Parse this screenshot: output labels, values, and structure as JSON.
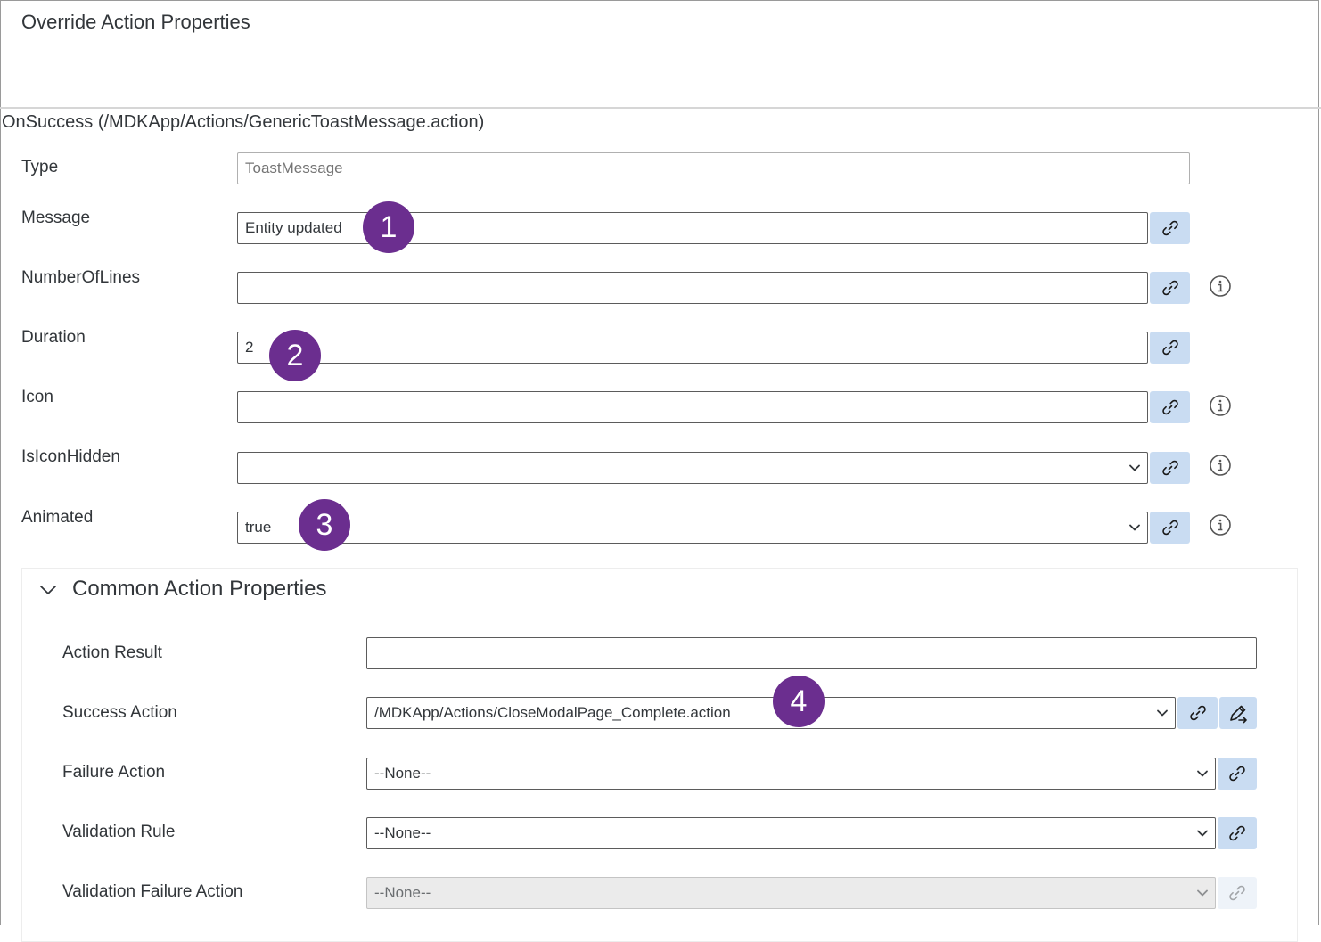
{
  "header": {
    "title": "Override Action Properties"
  },
  "section": {
    "title": "OnSuccess (/MDKApp/Actions/GenericToastMessage.action)"
  },
  "fields": {
    "type": {
      "label": "Type",
      "placeholder": "ToastMessage"
    },
    "message": {
      "label": "Message",
      "value": "Entity updated"
    },
    "number_of_lines": {
      "label": "NumberOfLines",
      "value": ""
    },
    "duration": {
      "label": "Duration",
      "value": "2"
    },
    "icon": {
      "label": "Icon",
      "value": ""
    },
    "is_icon_hidden": {
      "label": "IsIconHidden",
      "selected": ""
    },
    "animated": {
      "label": "Animated",
      "selected": "true"
    }
  },
  "common": {
    "title": "Common Action Properties",
    "action_result": {
      "label": "Action Result",
      "value": ""
    },
    "success_action": {
      "label": "Success Action",
      "selected": "/MDKApp/Actions/CloseModalPage_Complete.action"
    },
    "failure_action": {
      "label": "Failure Action",
      "selected": "--None--"
    },
    "validation_rule": {
      "label": "Validation Rule",
      "selected": "--None--"
    },
    "validation_failure_action": {
      "label": "Validation Failure Action",
      "selected": "--None--"
    }
  },
  "badges": [
    "1",
    "2",
    "3",
    "4"
  ],
  "icons": {
    "bind": "link-icon",
    "edit": "pencil-icon",
    "info": "info-icon",
    "dropdown": "chevron-down-icon",
    "collapse": "chevron-down-icon"
  },
  "colors": {
    "badge": "#6b2e8f",
    "button_bg": "#c9dcf2"
  }
}
